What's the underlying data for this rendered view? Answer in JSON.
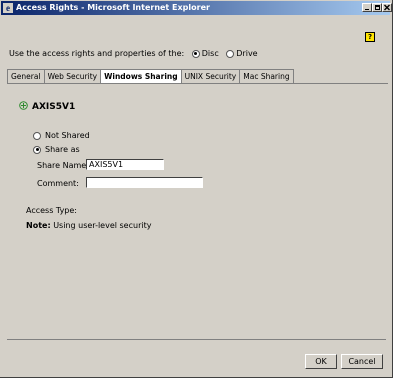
{
  "window": {
    "title": "Access Rights - Microsoft Internet Explorer"
  },
  "access": {
    "prompt": "Use the access rights and properties of the:",
    "options": [
      {
        "label": "Disc",
        "selected": true
      },
      {
        "label": "Drive",
        "selected": false
      }
    ]
  },
  "tabs": [
    {
      "label": "General",
      "active": false
    },
    {
      "label": "Web Security",
      "active": false
    },
    {
      "label": "Windows Sharing",
      "active": true
    },
    {
      "label": "UNIX Security",
      "active": false
    },
    {
      "label": "Mac Sharing",
      "active": false
    }
  ],
  "sharing": {
    "title": "AXIS5V1",
    "not_shared_label": "Not Shared",
    "share_as_label": "Share as",
    "share_name_label": "Share Name:",
    "share_name_value": "AXIS5V1",
    "comment_label": "Comment:",
    "comment_value": "",
    "access_type_label": "Access Type:",
    "note_label": "Note:",
    "note_text": "Using user-level security"
  },
  "buttons": {
    "ok": "OK",
    "cancel": "Cancel"
  },
  "icons": {
    "help": "?"
  }
}
